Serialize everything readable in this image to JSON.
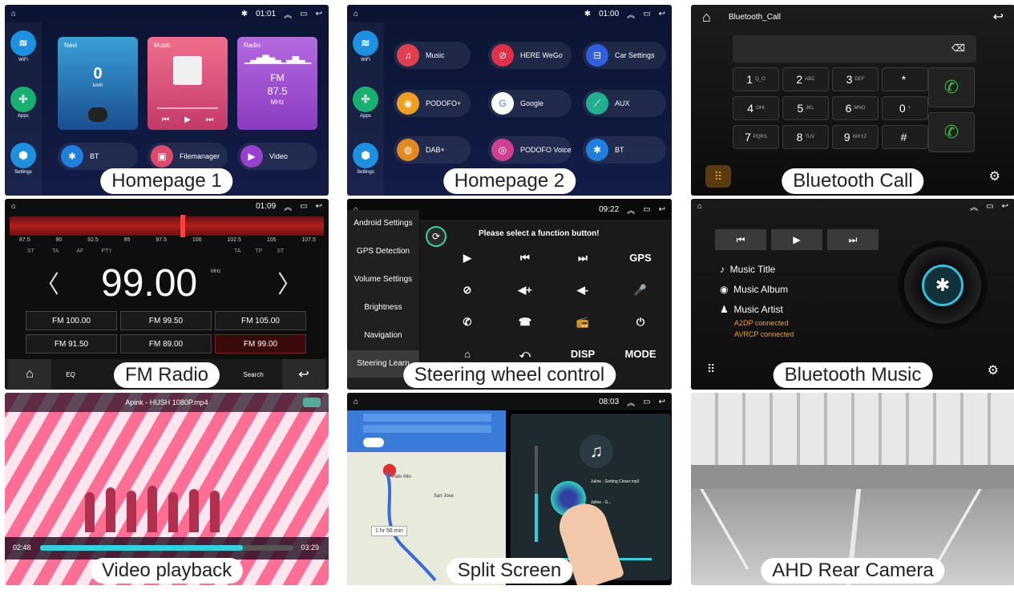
{
  "captions": {
    "p1": "Homepage 1",
    "p2": "Homepage 2",
    "p3": "Bluetooth Call",
    "p4": "FM Radio",
    "p5": "Steering wheel control",
    "p6": "Bluetooth Music",
    "p7": "Video playback",
    "p8": "Split Screen",
    "p9": "AHD Rear Camera"
  },
  "home1": {
    "time": "01:01",
    "side": [
      "WiFi",
      "Apps",
      "Settings"
    ],
    "cards": {
      "navi": {
        "label": "Navi",
        "speed": "0",
        "unit": "km/h"
      },
      "music": {
        "label": "Music"
      },
      "radio": {
        "label": "Radio",
        "band": "FM",
        "freq": "87.5",
        "unit": "MHz"
      }
    },
    "bottom": [
      "BT",
      "Filemanager",
      "Video"
    ]
  },
  "home2": {
    "time": "01:00",
    "side": [
      "WiFi",
      "Apps",
      "Settings"
    ],
    "apps": [
      "Music",
      "HERE WeGo",
      "Car Settings",
      "PODOFO+",
      "Google",
      "AUX",
      "DAB+",
      "PODOFO Voice",
      "BT"
    ]
  },
  "btcall": {
    "title": "Bluetooth_Call",
    "keys": [
      {
        "d": "1",
        "s": "Q_O"
      },
      {
        "d": "2",
        "s": "ABC"
      },
      {
        "d": "3",
        "s": "DEF"
      },
      {
        "d": "*",
        "s": ""
      },
      {
        "d": "4",
        "s": "GHI"
      },
      {
        "d": "5",
        "s": "JKL"
      },
      {
        "d": "6",
        "s": "MNO"
      },
      {
        "d": "0",
        "s": "+"
      },
      {
        "d": "7",
        "s": "PQRS"
      },
      {
        "d": "8",
        "s": "TUV"
      },
      {
        "d": "9",
        "s": "WXYZ"
      },
      {
        "d": "#",
        "s": ""
      }
    ]
  },
  "fm": {
    "time": "01:09",
    "scale": [
      "87.5",
      "90",
      "92.5",
      "95",
      "97.5",
      "100",
      "102.5",
      "105",
      "107.5"
    ],
    "flags": [
      "ST",
      "TA",
      "AF",
      "PTY"
    ],
    "rflags": [
      "TA",
      "TP",
      "ST"
    ],
    "freq": "99.00",
    "unit": "MHz",
    "presets": [
      "FM  100.00",
      "FM  99.50",
      "FM  105.00",
      "FM  91.50",
      "FM  89.00",
      "FM  99.00"
    ],
    "bottom": [
      "EQ",
      "Search"
    ]
  },
  "steering": {
    "time": "09:22",
    "prompt": "Please select a function button!",
    "menu": [
      "Android Settings",
      "GPS Detection",
      "Volume Settings",
      "Brightness",
      "Navigation",
      "Steering Learn"
    ],
    "buttons": [
      "▶",
      "⏮",
      "⏭",
      "GPS",
      "⊘",
      "◀+",
      "◀-",
      "🎤",
      "✆",
      "☎",
      "📻",
      "⏻",
      "⌂",
      "⤺",
      "DISP",
      "MODE"
    ]
  },
  "btmusic": {
    "title": "Music Title",
    "album": "Music Album",
    "artist": "Music Artist",
    "status1": "A2DP connected",
    "status2": "AVRCP connected",
    "accent": "#f0a020"
  },
  "video": {
    "title": "Apink - HUSH 1080P.mp4",
    "elapsed": "02:48",
    "total": "03:29",
    "progress": 0.8
  },
  "split": {
    "time": "08:03",
    "route_time": "1 hr 58 min",
    "song1": "Juline - Getting Closer.mp3",
    "song2": "Juline - G...",
    "places": [
      "Palo Alto",
      "San Jose"
    ]
  }
}
